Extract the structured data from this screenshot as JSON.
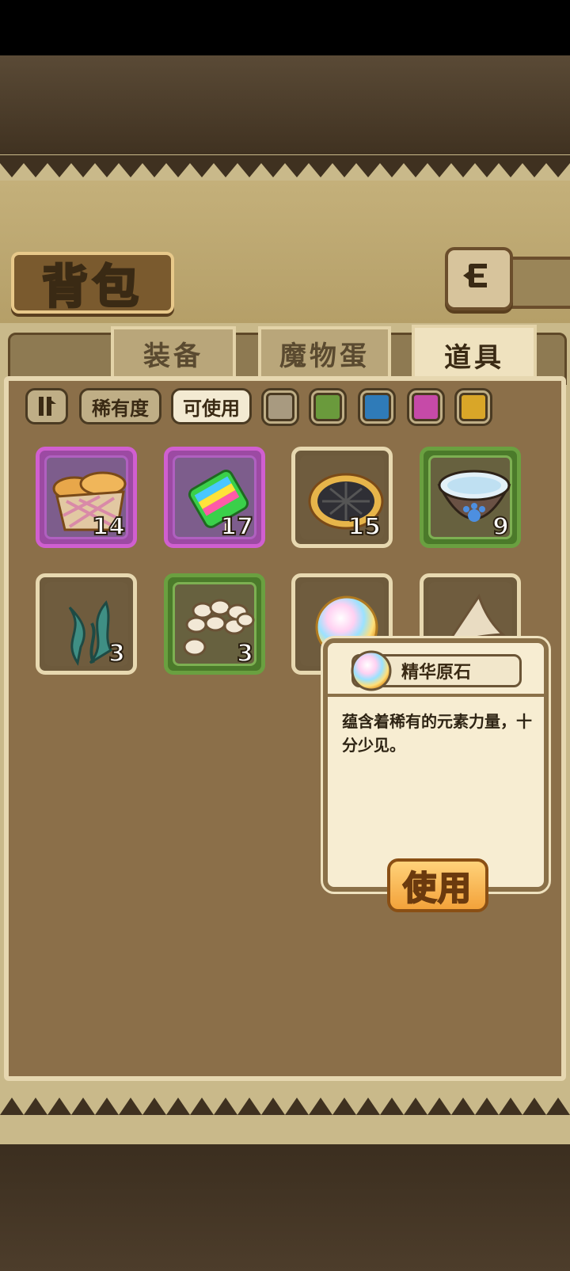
{
  "header": {
    "title": "背包"
  },
  "tabs": [
    {
      "label": "装备",
      "active": false
    },
    {
      "label": "魔物蛋",
      "active": false
    },
    {
      "label": "道具",
      "active": true
    }
  ],
  "filters": {
    "sort_icon": "sort-toggle-icon",
    "rarity_label": "稀有度",
    "usable_label": "可使用",
    "rarity_colors": [
      "#a89a80",
      "#6a9a3c",
      "#2f7bb8",
      "#c64aa8",
      "#d9a628"
    ]
  },
  "items": [
    {
      "icon": "bread-basket-icon",
      "rarity": "purple",
      "count": "14"
    },
    {
      "icon": "rainbow-candy-icon",
      "rarity": "purple",
      "count": "17"
    },
    {
      "icon": "dark-pie-icon",
      "rarity": "plain",
      "count": "15"
    },
    {
      "icon": "water-bowl-icon",
      "rarity": "green",
      "count": "9"
    },
    {
      "icon": "seaweed-icon",
      "rarity": "plain",
      "count": "3"
    },
    {
      "icon": "beans-icon",
      "rarity": "green",
      "count": "3"
    },
    {
      "icon": "rainbow-gem-icon",
      "rarity": "plain",
      "count": ""
    },
    {
      "icon": "fang-icon",
      "rarity": "plain",
      "count": ""
    }
  ],
  "tooltip": {
    "item_name": "精华原石",
    "description": "蕴含着稀有的元素力量，十分少见。",
    "use_label": "使用"
  }
}
